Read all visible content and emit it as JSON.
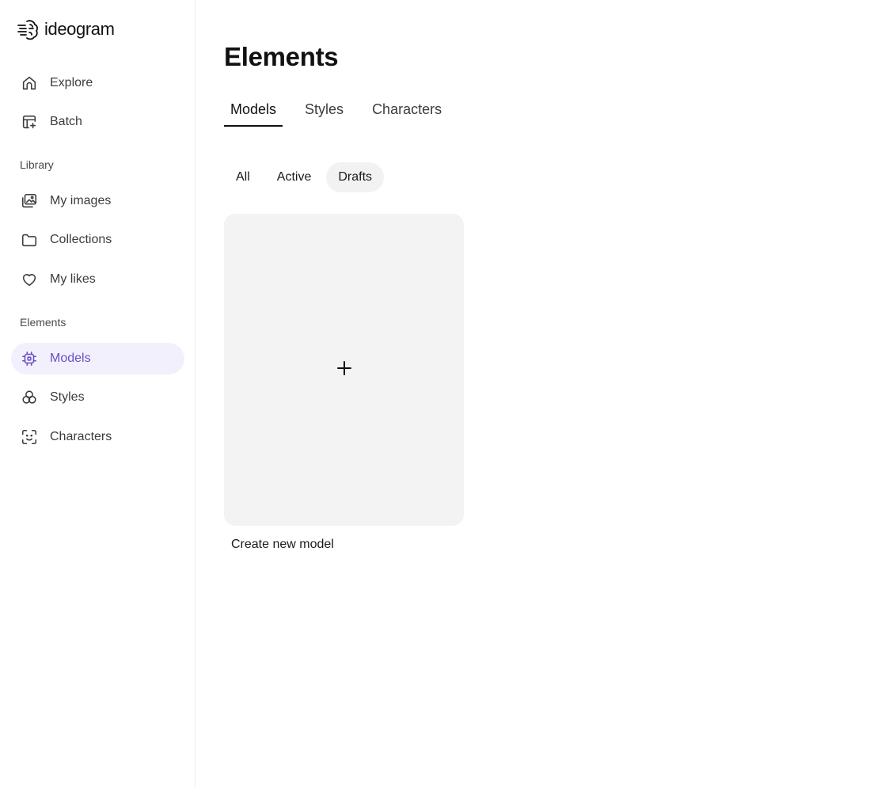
{
  "brand": {
    "name": "ideogram"
  },
  "sidebar": {
    "primary": [
      {
        "label": "Explore",
        "icon": "home-icon"
      },
      {
        "label": "Batch",
        "icon": "batch-icon"
      }
    ],
    "library_heading": "Library",
    "library": [
      {
        "label": "My images",
        "icon": "images-icon"
      },
      {
        "label": "Collections",
        "icon": "folder-icon"
      },
      {
        "label": "My likes",
        "icon": "heart-icon"
      }
    ],
    "elements_heading": "Elements",
    "elements": [
      {
        "label": "Models",
        "icon": "chip-icon",
        "active": true
      },
      {
        "label": "Styles",
        "icon": "styles-icon"
      },
      {
        "label": "Characters",
        "icon": "face-scan-icon"
      }
    ]
  },
  "main": {
    "title": "Elements",
    "tabs": [
      {
        "label": "Models",
        "active": true
      },
      {
        "label": "Styles"
      },
      {
        "label": "Characters"
      }
    ],
    "filters": [
      {
        "label": "All"
      },
      {
        "label": "Active"
      },
      {
        "label": "Drafts",
        "active": true
      }
    ],
    "create_card": {
      "caption": "Create new model",
      "icon": "plus-icon"
    }
  },
  "colors": {
    "accent": "#6b4fc4",
    "accent_bg": "#f3f0fd",
    "card_bg": "#f3f3f3",
    "chip_bg": "#f2f2f2"
  }
}
